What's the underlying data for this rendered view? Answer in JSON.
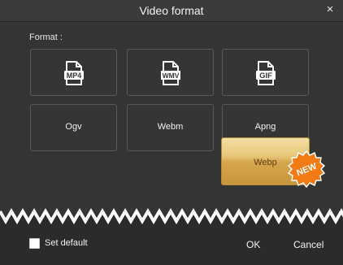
{
  "window": {
    "title": "Video format",
    "close_glyph": "×"
  },
  "format_label": "Format :",
  "formats": [
    {
      "label": "MP4",
      "icon": "mp4-file-icon"
    },
    {
      "label": "WMV",
      "icon": "wmv-file-icon"
    },
    {
      "label": "GIF",
      "icon": "gif-file-icon"
    },
    {
      "label": "Ogv"
    },
    {
      "label": "Webm"
    },
    {
      "label": "Apng"
    }
  ],
  "webp": {
    "label": "Webp",
    "badge": "NEW"
  },
  "footer": {
    "set_default_label": "Set default",
    "set_default_checked": false,
    "ok_label": "OK",
    "cancel_label": "Cancel"
  },
  "colors": {
    "background": "#2b2b2b",
    "content": "#343434",
    "button_border": "#595959",
    "webp_gold": "#e8c679",
    "badge_orange": "#f47a14"
  }
}
